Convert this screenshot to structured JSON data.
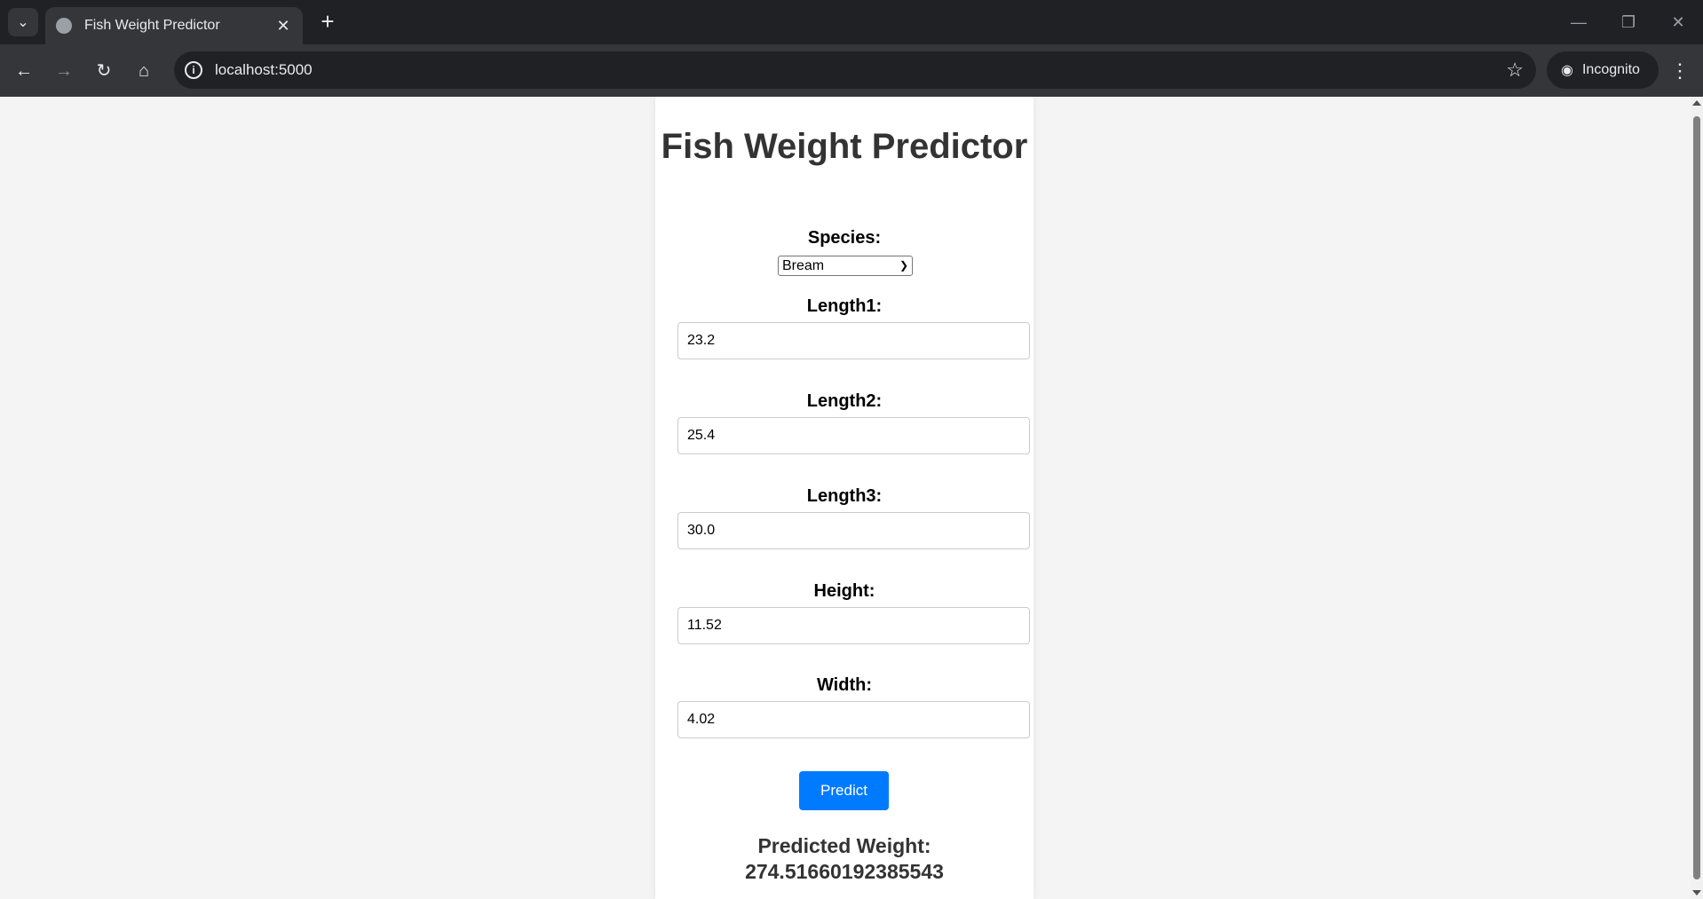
{
  "browser": {
    "tab_title": "Fish Weight Predictor",
    "url": "localhost:5000",
    "incognito_label": "Incognito",
    "icons": {
      "tab_menu": "chevron-down-icon",
      "tab_favicon": "globe-icon",
      "tab_close": "close-icon",
      "new_tab": "plus-icon",
      "back": "arrow-left-icon",
      "forward": "arrow-right-icon",
      "reload": "reload-icon",
      "home": "home-icon",
      "site_info": "info-icon",
      "bookmark": "star-icon",
      "menu": "kebab-icon"
    }
  },
  "page": {
    "title": "Fish Weight Predictor",
    "species_label": "Species:",
    "species_selected": "Bream",
    "fields": [
      {
        "label": "Length1:",
        "value": "23.2"
      },
      {
        "label": "Length2:",
        "value": "25.4"
      },
      {
        "label": "Length3:",
        "value": "30.0"
      },
      {
        "label": "Height:",
        "value": "11.52"
      },
      {
        "label": "Width:",
        "value": "4.02"
      }
    ],
    "predict_label": "Predict",
    "result_label": "Predicted Weight:",
    "result_value": "274.51660192385543"
  },
  "colors": {
    "button": "#007bff",
    "title": "#333333",
    "page_bg": "#f4f4f4"
  }
}
